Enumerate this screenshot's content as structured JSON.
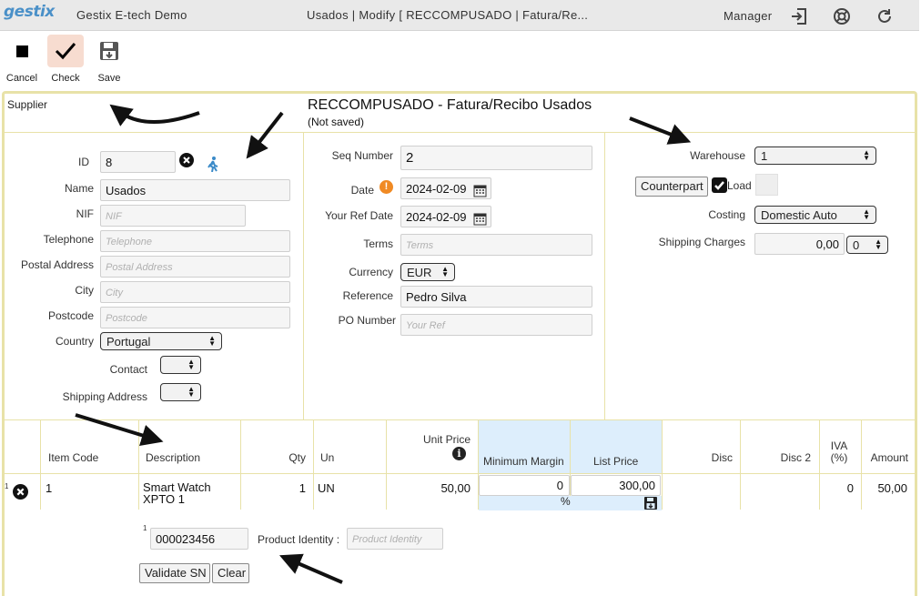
{
  "topbar": {
    "logo": "gestix",
    "company": "Gestix E-tech Demo",
    "window_title": "Usados | Modify [ RECCOMPUSADO | Fatura/Re...",
    "user": "Manager"
  },
  "toolbar": {
    "cancel": "Cancel",
    "check": "Check",
    "save": "Save"
  },
  "form": {
    "section_label": "Supplier",
    "title": "RECCOMPUSADO - Fatura/Recibo Usados",
    "status": "(Not saved)"
  },
  "supplier": {
    "id_label": "ID",
    "id_value": "8",
    "name_label": "Name",
    "name_value": "Usados",
    "nif_label": "NIF",
    "nif_placeholder": "NIF",
    "telephone_label": "Telephone",
    "telephone_placeholder": "Telephone",
    "postal_label": "Postal Address",
    "postal_placeholder": "Postal Address",
    "city_label": "City",
    "city_placeholder": "City",
    "postcode_label": "Postcode",
    "postcode_placeholder": "Postcode",
    "country_label": "Country",
    "country_value": "Portugal",
    "contact_label": "Contact",
    "shipping_label": "Shipping Address"
  },
  "document": {
    "seq_label": "Seq Number",
    "seq_value": "2",
    "date_label": "Date",
    "date_value": "2024-02-09",
    "refdate_label": "Your Ref Date",
    "refdate_value": "2024-02-09",
    "terms_label": "Terms",
    "terms_placeholder": "Terms",
    "currency_label": "Currency",
    "currency_value": "EUR",
    "reference_label": "Reference",
    "reference_value": "Pedro Silva",
    "po_label": "PO Number",
    "po_placeholder": "Your Ref"
  },
  "warehouse": {
    "warehouse_label": "Warehouse",
    "warehouse_value": "1",
    "counterpart_label": "Counterpart",
    "load_label": "Load",
    "costing_label": "Costing",
    "costing_value": "Domestic Auto",
    "shipping_label": "Shipping Charges",
    "shipping_value": "0,00",
    "shipping_select": "0"
  },
  "table": {
    "columns": [
      "Item Code",
      "Description",
      "Qty",
      "Un",
      "Unit Price",
      "Minimum Margin",
      "List Price",
      "Disc",
      "Disc 2",
      "IVA\n(%)",
      "Amount"
    ],
    "rows": [
      {
        "index": "1",
        "item_code": "1",
        "description": "Smart Watch XPTO 1",
        "qty": "1",
        "un": "UN",
        "unit_price": "50,00",
        "min_margin": "0",
        "list_price": "300,00",
        "percent": "%",
        "iva": "0",
        "amount": "50,00"
      }
    ]
  },
  "serial": {
    "index": "1",
    "serial_value": "000023456",
    "identity_label": "Product Identity :",
    "identity_placeholder": "Product Identity",
    "validate": "Validate SN",
    "clear": "Clear"
  },
  "colors": {
    "frame": "#e8e2a8",
    "topbar": "#e9e9e9",
    "accent_blue": "#4a90c8",
    "highlight": "#ddeefc",
    "check_bg": "#f7dcd0",
    "warn": "#f08a24"
  }
}
